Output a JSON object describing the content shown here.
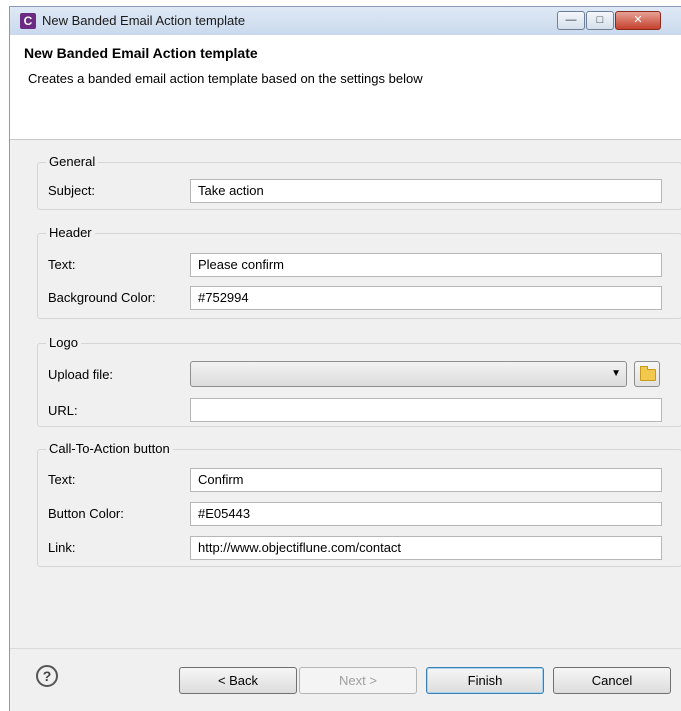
{
  "window": {
    "title": "New Banded Email Action template",
    "app_icon_letter": "C",
    "controls": {
      "minimize": "—",
      "maximize": "□",
      "close": "✕"
    }
  },
  "header": {
    "title": "New Banded Email Action template",
    "description": "Creates a banded email action template based on the settings below"
  },
  "general": {
    "legend": "General",
    "subject_label": "Subject:",
    "subject_value": "Take action"
  },
  "header_group": {
    "legend": "Header",
    "text_label": "Text:",
    "text_value": "Please confirm",
    "bg_color_label": "Background Color:",
    "bg_color_value": "#752994"
  },
  "logo": {
    "legend": "Logo",
    "upload_label": "Upload file:",
    "upload_value": "",
    "url_label": "URL:",
    "url_value": "",
    "dropdown_icon": "chevron-down-icon",
    "browse_icon": "folder-icon"
  },
  "cta": {
    "legend": "Call-To-Action button",
    "text_label": "Text:",
    "text_value": "Confirm",
    "button_color_label": "Button Color:",
    "button_color_value": "#E05443",
    "link_label": "Link:",
    "link_value": "http://www.objectiflune.com/contact"
  },
  "footer": {
    "help_icon": "help-icon",
    "help_glyph": "?",
    "back": "< Back",
    "next": "Next >",
    "finish": "Finish",
    "cancel": "Cancel"
  },
  "colors": {
    "accent": "#752994",
    "brand_icon": "#6b2b82"
  }
}
